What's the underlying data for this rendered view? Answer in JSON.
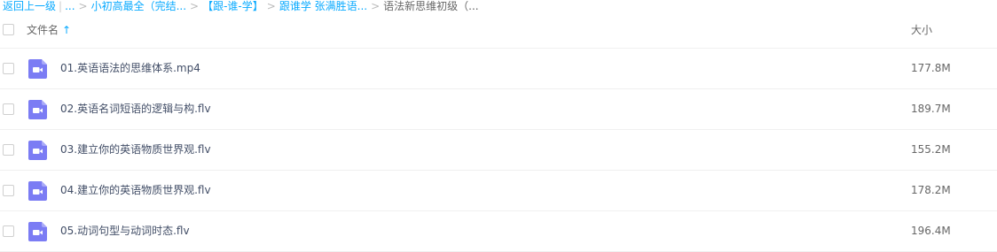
{
  "breadcrumb": {
    "back": "返回上一级",
    "items": [
      "...",
      "小初高最全（完结...",
      "【跟-谁-学】",
      "跟谁学 张满胜语...",
      "语法新思维初级（..."
    ]
  },
  "header": {
    "name_label": "文件名",
    "sort_arrow": "↑",
    "size_label": "大小"
  },
  "files": [
    {
      "name": "01.英语语法的思维体系.mp4",
      "size": "177.8M"
    },
    {
      "name": "02.英语名词短语的逻辑与构.flv",
      "size": "189.7M"
    },
    {
      "name": "03.建立你的英语物质世界观.flv",
      "size": "155.2M"
    },
    {
      "name": "04.建立你的英语物质世界观.flv",
      "size": "178.2M"
    },
    {
      "name": "05.动词句型与动词时态.flv",
      "size": "196.4M"
    }
  ],
  "colors": {
    "link": "#09aaff",
    "icon": "#7b7cf4"
  }
}
